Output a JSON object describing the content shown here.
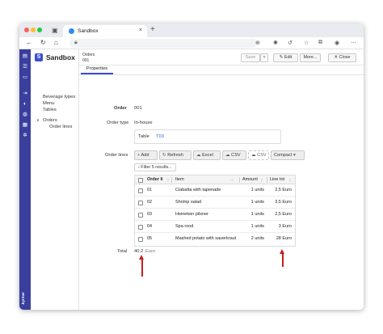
{
  "browser": {
    "tab_title": "Sandbox",
    "tab_close": "×",
    "new_tab": "+"
  },
  "app": {
    "logo_letter": "S",
    "name": "Sandbox",
    "brand": "kyrmer"
  },
  "sidebar": {
    "items": [
      "Beverage types",
      "Menu",
      "Tables"
    ],
    "group_label": "Orders",
    "group_chevron": "∨",
    "sub_items": [
      "Order lines"
    ]
  },
  "breadcrumb": {
    "section": "Orders",
    "id": "001"
  },
  "toolbar": {
    "save": "Save",
    "edit": "Edit",
    "more": "More...",
    "close": "Close"
  },
  "tabs": {
    "properties": "Properties"
  },
  "form": {
    "order_label": "Order",
    "order_value": "001",
    "order_type_label": "Order type",
    "order_type_value": "In-house",
    "table_label": "Table",
    "table_value": "T03",
    "order_lines_label": "Order lines",
    "total_label": "Total",
    "total_value": "40.2",
    "total_unit": "Euro"
  },
  "lines_toolbar": {
    "add": "Add",
    "refresh": "Refresh",
    "excel": "Excel",
    "csv": "CSV",
    "csv2": "CSV",
    "compact": "Compact"
  },
  "filter": {
    "label": "Filter 5 results..."
  },
  "grid": {
    "headers": [
      "Order li",
      "Item",
      "Amount",
      "Line tot"
    ],
    "rows": [
      {
        "line": "01",
        "item": "Ciabatta with tapenade",
        "amount": "1 units",
        "total": "2,5 Euro"
      },
      {
        "line": "02",
        "item": "Shrimp salad",
        "amount": "1 units",
        "total": "3,5 Euro"
      },
      {
        "line": "03",
        "item": "Heineken pilsner",
        "amount": "1 units",
        "total": "2,5 Euro"
      },
      {
        "line": "04",
        "item": "Spa rood",
        "amount": "1 units",
        "total": "3 Euro"
      },
      {
        "line": "05",
        "item": "Mashed potato with sauerkraut",
        "amount": "2 units",
        "total": "28 Euro"
      }
    ]
  },
  "colors": {
    "rail": "#3a3f9e",
    "accent": "#3a4fcf",
    "link": "#2d6ad6",
    "arrow": "#c62020"
  }
}
